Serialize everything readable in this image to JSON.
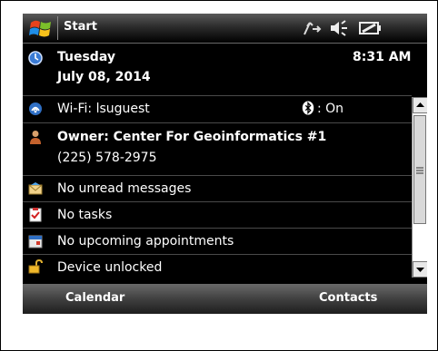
{
  "titlebar": {
    "title": "Start"
  },
  "date": {
    "weekday": "Tuesday",
    "date": "July 08, 2014",
    "time": "8:31 AM"
  },
  "wifi": {
    "label": "Wi-Fi: lsuguest",
    "bluetooth": ": On"
  },
  "owner": {
    "name": "Owner: Center For Geoinformatics #1",
    "phone": "(225) 578-2975"
  },
  "messages": {
    "label": "No unread messages"
  },
  "tasks": {
    "label": "No tasks"
  },
  "appointments": {
    "label": "No upcoming appointments"
  },
  "device": {
    "label": "Device unlocked"
  },
  "softkeys": {
    "left": "Calendar",
    "right": "Contacts"
  },
  "colors": {
    "screen_bg": "#000000",
    "text": "#ffffff",
    "separator": "#4a4a4a"
  }
}
